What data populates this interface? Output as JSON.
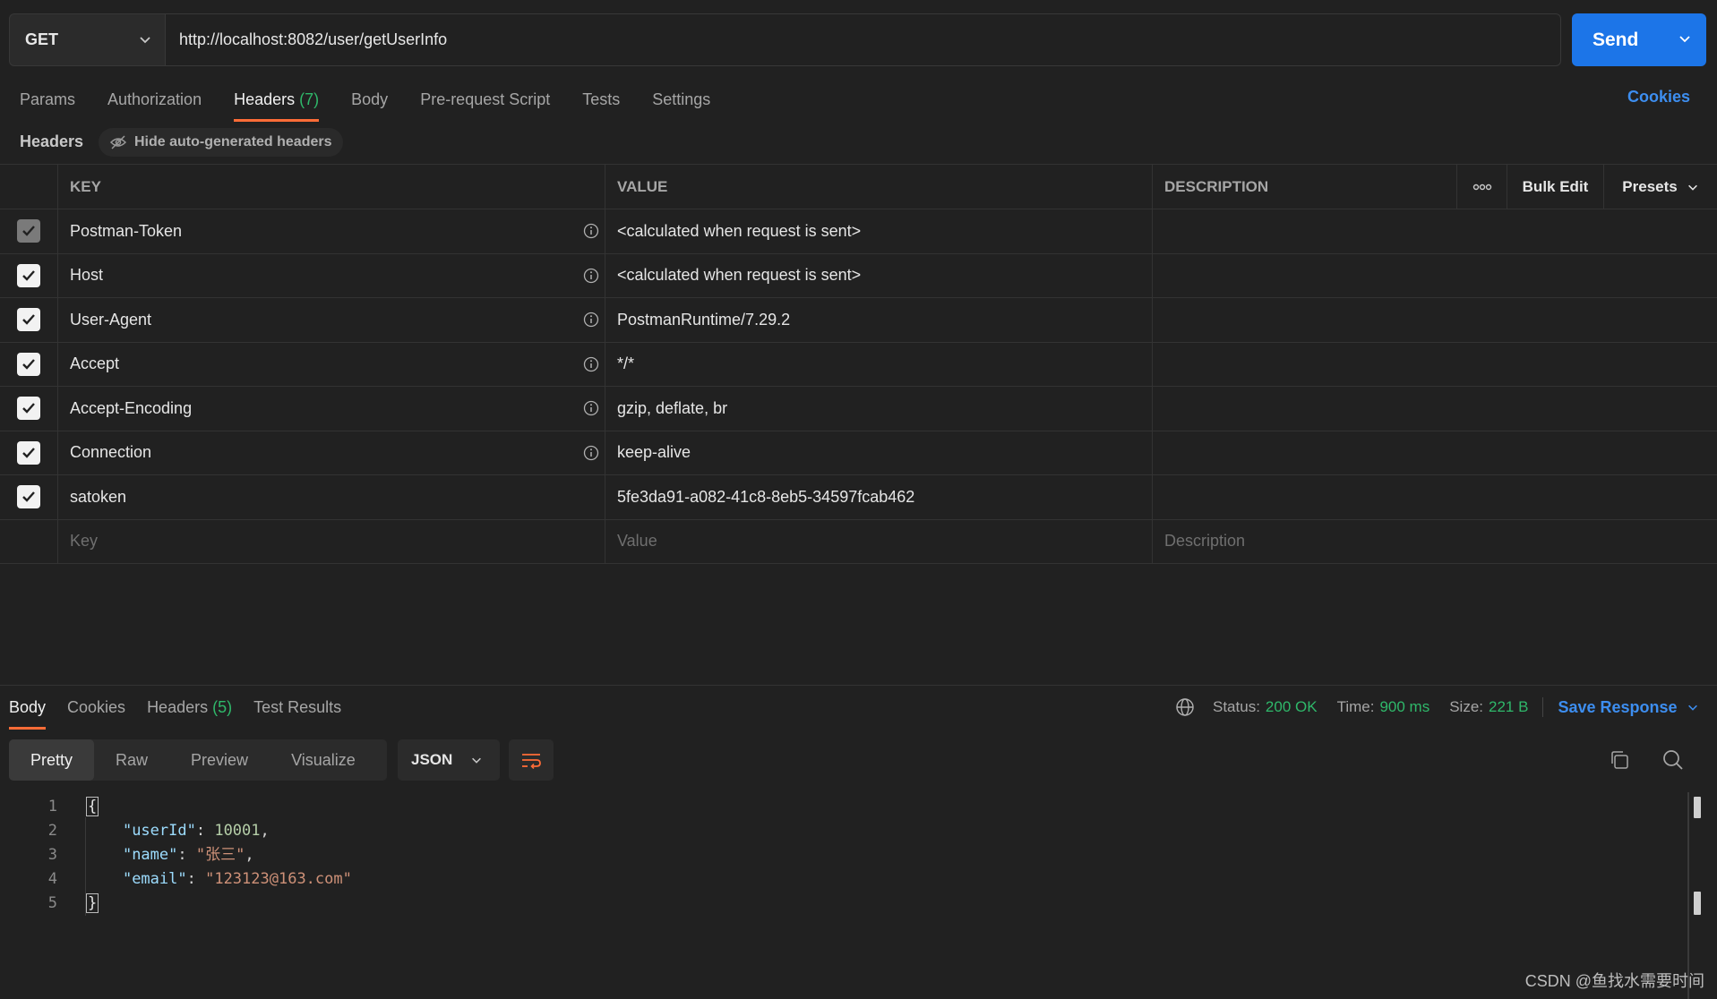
{
  "request": {
    "method": "GET",
    "url": "http://localhost:8082/user/getUserInfo",
    "send_label": "Send"
  },
  "req_tabs": [
    {
      "label": "Params"
    },
    {
      "label": "Authorization"
    },
    {
      "label": "Headers",
      "count": "(7)"
    },
    {
      "label": "Body"
    },
    {
      "label": "Pre-request Script"
    },
    {
      "label": "Tests"
    },
    {
      "label": "Settings"
    }
  ],
  "cookies_link": "Cookies",
  "headers_section": {
    "title": "Headers",
    "hide_auto": "Hide auto-generated headers"
  },
  "table": {
    "columns": {
      "key": "KEY",
      "value": "VALUE",
      "description": "DESCRIPTION"
    },
    "bulk_edit": "Bulk Edit",
    "presets": "Presets",
    "rows": [
      {
        "key": "Postman-Token",
        "value": "<calculated when request is sent>"
      },
      {
        "key": "Host",
        "value": "<calculated when request is sent>"
      },
      {
        "key": "User-Agent",
        "value": "PostmanRuntime/7.29.2"
      },
      {
        "key": "Accept",
        "value": "*/*"
      },
      {
        "key": "Accept-Encoding",
        "value": "gzip, deflate, br"
      },
      {
        "key": "Connection",
        "value": "keep-alive"
      },
      {
        "key": "satoken",
        "value": "5fe3da91-a082-41c8-8eb5-34597fcab462"
      }
    ],
    "placeholders": {
      "key": "Key",
      "value": "Value",
      "description": "Description"
    }
  },
  "response": {
    "tabs": [
      {
        "label": "Body"
      },
      {
        "label": "Cookies"
      },
      {
        "label": "Headers",
        "count": "(5)"
      },
      {
        "label": "Test Results"
      }
    ],
    "status_label": "Status:",
    "status_value": "200 OK",
    "time_label": "Time:",
    "time_value": "900 ms",
    "size_label": "Size:",
    "size_value": "221 B",
    "save_response": "Save Response",
    "views": [
      "Pretty",
      "Raw",
      "Preview",
      "Visualize"
    ],
    "format": "JSON",
    "code": {
      "line_numbers": [
        "1",
        "2",
        "3",
        "4",
        "5"
      ],
      "open_brace": "{",
      "close_brace": "}",
      "entries": [
        {
          "key": "\"userId\"",
          "value": "10001",
          "trail": ","
        },
        {
          "key": "\"name\"",
          "value": "\"张三\"",
          "trail": ","
        },
        {
          "key": "\"email\"",
          "value": "\"123123@163.com\"",
          "trail": ""
        }
      ]
    }
  },
  "watermark": "CSDN @鱼找水需要时间",
  "colors": {
    "accent": "#ff6c37",
    "send": "#1c75e8",
    "link": "#3d8ef0",
    "success": "#2fb86a",
    "background": "#212121"
  }
}
